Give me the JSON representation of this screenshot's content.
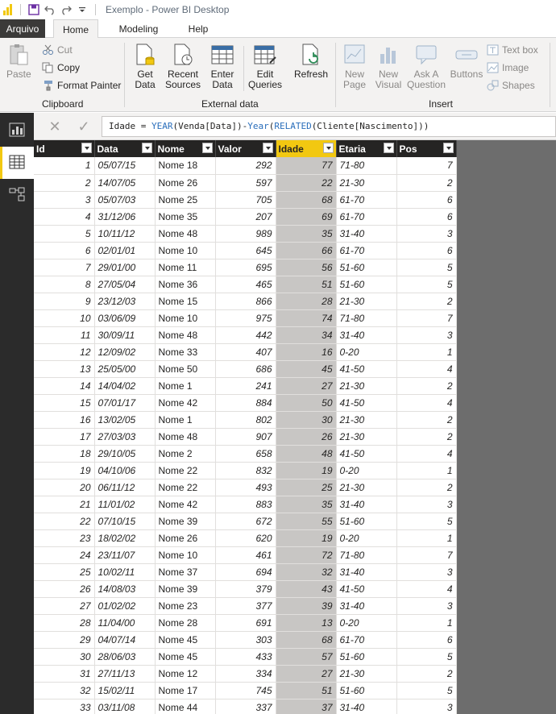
{
  "window": {
    "title": "Exemplo - Power BI Desktop"
  },
  "tabs": {
    "file": "Arquivo",
    "home": "Home",
    "modeling": "Modeling",
    "help": "Help"
  },
  "ribbon": {
    "clipboard": {
      "paste": "Paste",
      "cut": "Cut",
      "copy": "Copy",
      "format_painter": "Format Painter",
      "label": "Clipboard"
    },
    "external": {
      "get_data_1": "Get",
      "get_data_2": "Data",
      "recent_1": "Recent",
      "recent_2": "Sources",
      "enter_1": "Enter",
      "enter_2": "Data",
      "edit_1": "Edit",
      "edit_2": "Queries",
      "refresh": "Refresh",
      "label": "External data"
    },
    "insert": {
      "new_page_1": "New",
      "new_page_2": "Page",
      "new_visual_1": "New",
      "new_visual_2": "Visual",
      "ask_1": "Ask A",
      "ask_2": "Question",
      "buttons": "Buttons",
      "text_box": "Text box",
      "image": "Image",
      "shapes": "Shapes",
      "label": "Insert"
    }
  },
  "formula": {
    "prefix": "Idade = ",
    "fn1": "YEAR",
    "arg1": "(Venda[Data])-",
    "fn2": "Year",
    "open": "(",
    "fn3": "RELATED",
    "arg3": "(Cliente[Nascimento]))"
  },
  "columns": [
    "Id",
    "Data",
    "Nome",
    "Valor",
    "Idade",
    "Etaria",
    "Pos"
  ],
  "rows": [
    [
      1,
      "05/07/15",
      "Nome 18",
      292,
      77,
      "71-80",
      7
    ],
    [
      2,
      "14/07/05",
      "Nome 26",
      597,
      22,
      "21-30",
      2
    ],
    [
      3,
      "05/07/03",
      "Nome 25",
      705,
      68,
      "61-70",
      6
    ],
    [
      4,
      "31/12/06",
      "Nome 35",
      207,
      69,
      "61-70",
      6
    ],
    [
      5,
      "10/11/12",
      "Nome 48",
      989,
      35,
      "31-40",
      3
    ],
    [
      6,
      "02/01/01",
      "Nome 10",
      645,
      66,
      "61-70",
      6
    ],
    [
      7,
      "29/01/00",
      "Nome 11",
      695,
      56,
      "51-60",
      5
    ],
    [
      8,
      "27/05/04",
      "Nome 36",
      465,
      51,
      "51-60",
      5
    ],
    [
      9,
      "23/12/03",
      "Nome 15",
      866,
      28,
      "21-30",
      2
    ],
    [
      10,
      "03/06/09",
      "Nome 10",
      975,
      74,
      "71-80",
      7
    ],
    [
      11,
      "30/09/11",
      "Nome 48",
      442,
      34,
      "31-40",
      3
    ],
    [
      12,
      "12/09/02",
      "Nome 33",
      407,
      16,
      "0-20",
      1
    ],
    [
      13,
      "25/05/00",
      "Nome 50",
      686,
      45,
      "41-50",
      4
    ],
    [
      14,
      "14/04/02",
      "Nome 1",
      241,
      27,
      "21-30",
      2
    ],
    [
      15,
      "07/01/17",
      "Nome 42",
      884,
      50,
      "41-50",
      4
    ],
    [
      16,
      "13/02/05",
      "Nome 1",
      802,
      30,
      "21-30",
      2
    ],
    [
      17,
      "27/03/03",
      "Nome 48",
      907,
      26,
      "21-30",
      2
    ],
    [
      18,
      "29/10/05",
      "Nome 2",
      658,
      48,
      "41-50",
      4
    ],
    [
      19,
      "04/10/06",
      "Nome 22",
      832,
      19,
      "0-20",
      1
    ],
    [
      20,
      "06/11/12",
      "Nome 22",
      493,
      25,
      "21-30",
      2
    ],
    [
      21,
      "11/01/02",
      "Nome 42",
      883,
      35,
      "31-40",
      3
    ],
    [
      22,
      "07/10/15",
      "Nome 39",
      672,
      55,
      "51-60",
      5
    ],
    [
      23,
      "18/02/02",
      "Nome 26",
      620,
      19,
      "0-20",
      1
    ],
    [
      24,
      "23/11/07",
      "Nome 10",
      461,
      72,
      "71-80",
      7
    ],
    [
      25,
      "10/02/11",
      "Nome 37",
      694,
      32,
      "31-40",
      3
    ],
    [
      26,
      "14/08/03",
      "Nome 39",
      379,
      43,
      "41-50",
      4
    ],
    [
      27,
      "01/02/02",
      "Nome 23",
      377,
      39,
      "31-40",
      3
    ],
    [
      28,
      "11/04/00",
      "Nome 28",
      691,
      13,
      "0-20",
      1
    ],
    [
      29,
      "04/07/14",
      "Nome 45",
      303,
      68,
      "61-70",
      6
    ],
    [
      30,
      "28/06/03",
      "Nome 45",
      433,
      57,
      "51-60",
      5
    ],
    [
      31,
      "27/11/13",
      "Nome 12",
      334,
      27,
      "21-30",
      2
    ],
    [
      32,
      "15/02/11",
      "Nome 17",
      745,
      51,
      "51-60",
      5
    ],
    [
      33,
      "03/11/08",
      "Nome 44",
      337,
      37,
      "31-40",
      3
    ]
  ],
  "selected_column": "Idade",
  "colors": {
    "accent": "#f2c811",
    "rail": "#2b2b2b",
    "header": "#252423",
    "canvas": "#6d6d6d"
  }
}
